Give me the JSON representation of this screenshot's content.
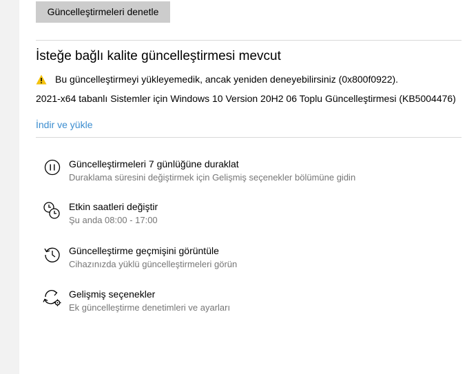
{
  "toolbar": {
    "check_updates_label": "Güncelleştirmeleri denetle"
  },
  "optional_update": {
    "title": "İsteğe bağlı kalite güncelleştirmesi mevcut",
    "warning_text": "Bu güncelleştirmeyi yükleyemedik, ancak yeniden deneyebilirsiniz (0x800f0922).",
    "update_name": "2021-x64 tabanlı Sistemler için Windows 10 Version 20H2 06 Toplu Güncelleştirmesi (KB5004476)",
    "install_link": "İndir ve yükle",
    "warning_color": "#f4c20d",
    "link_color": "#3a8ccf"
  },
  "options": [
    {
      "icon": "pause-icon",
      "title": "Güncelleştirmeleri 7 günlüğüne duraklat",
      "description": "Duraklama süresini değiştirmek için Gelişmiş seçenekler bölümüne gidin"
    },
    {
      "icon": "active-hours-icon",
      "title": "Etkin saatleri değiştir",
      "description": "Şu anda 08:00 - 17:00"
    },
    {
      "icon": "history-icon",
      "title": "Güncelleştirme geçmişini görüntüle",
      "description": "Cihazınızda yüklü güncelleştirmeleri görün"
    },
    {
      "icon": "advanced-options-icon",
      "title": "Gelişmiş seçenekler",
      "description": "Ek güncelleştirme denetimleri ve ayarları"
    }
  ]
}
